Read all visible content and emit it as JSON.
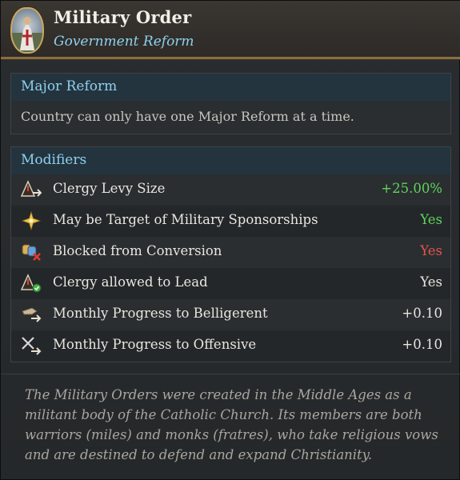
{
  "header": {
    "title": "Military Order",
    "subtitle": "Government Reform"
  },
  "major_reform": {
    "heading": "Major Reform",
    "text": "Country can only have one Major Reform at a time."
  },
  "modifiers": {
    "heading": "Modifiers",
    "rows": [
      {
        "icon": "clergy-levy-icon",
        "label": "Clergy Levy Size",
        "value": "+25.00%",
        "color": "#5fd35a"
      },
      {
        "icon": "sponsorship-star-icon",
        "label": "May be Target of Military Sponsorships",
        "value": "Yes",
        "color": "#5fd35a"
      },
      {
        "icon": "conversion-blocked-icon",
        "label": "Blocked from Conversion",
        "value": "Yes",
        "color": "#e2544c"
      },
      {
        "icon": "clergy-lead-icon",
        "label": "Clergy allowed to Lead",
        "value": "Yes",
        "color": "#e9e6df"
      },
      {
        "icon": "belligerent-progress-icon",
        "label": "Monthly Progress to Belligerent",
        "value": "+0.10",
        "color": "#e9e6df"
      },
      {
        "icon": "offensive-progress-icon",
        "label": "Monthly Progress to Offensive",
        "value": "+0.10",
        "color": "#e9e6df"
      }
    ]
  },
  "flavor_text": "The Military Orders were created in the Middle Ages as a militant body of the Catholic Church. Its members are both warriors (miles) and monks (fratres), who take religious vows and are destined to defend and expand Christianity."
}
